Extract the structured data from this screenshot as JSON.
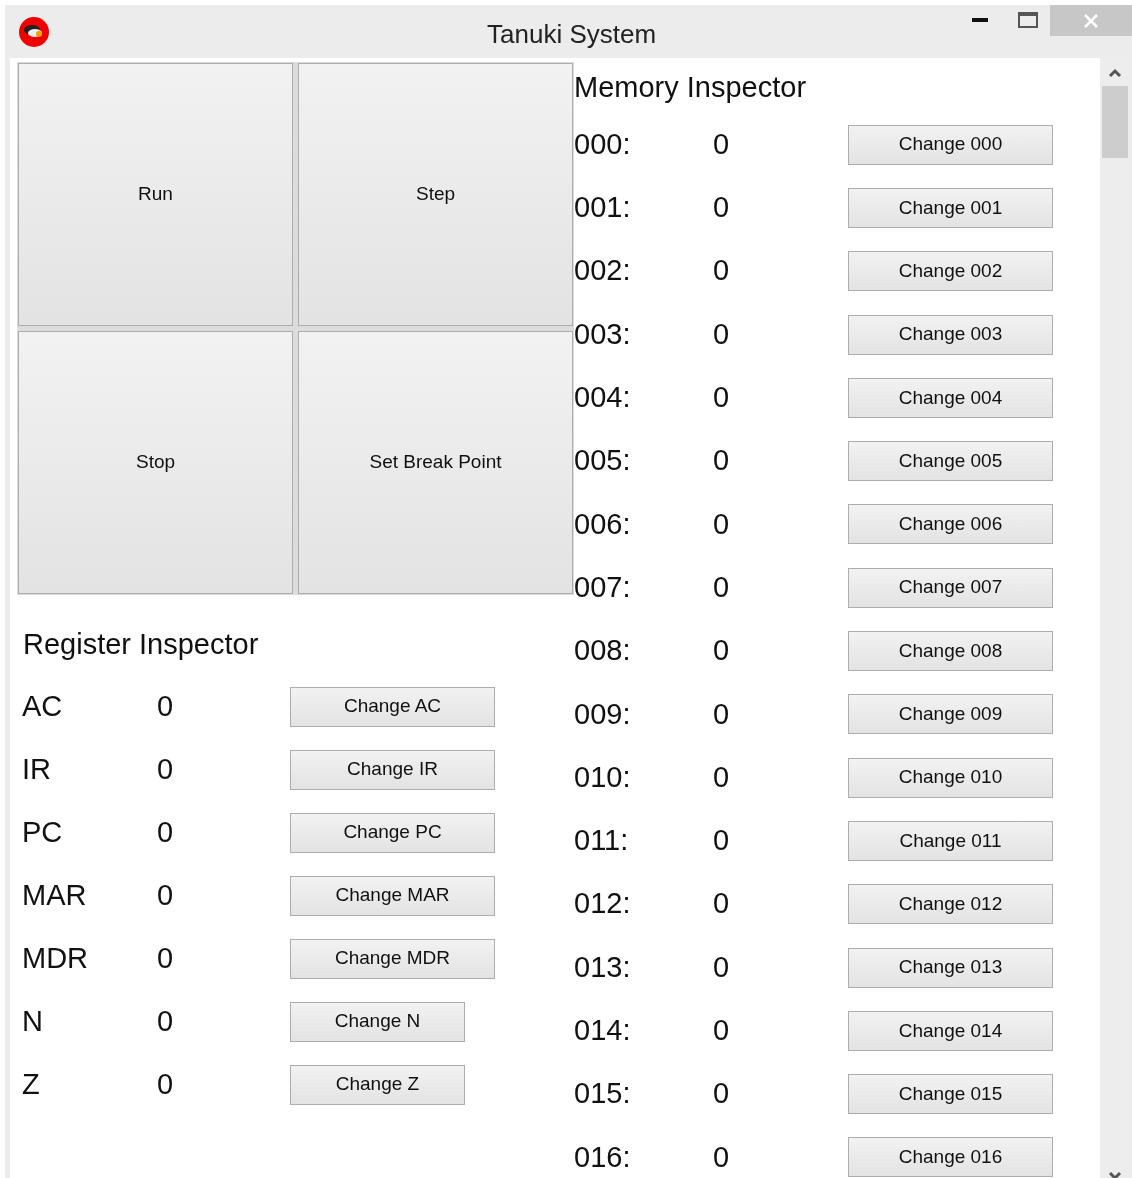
{
  "window": {
    "title": "Tanuki System"
  },
  "controls": [
    "Run",
    "Step",
    "Stop",
    "Set Break Point"
  ],
  "register_inspector": {
    "title": "Register Inspector",
    "rows": [
      {
        "name": "AC",
        "value": "0",
        "button": "Change AC",
        "kind": "wide"
      },
      {
        "name": "IR",
        "value": "0",
        "button": "Change IR",
        "kind": "wide"
      },
      {
        "name": "PC",
        "value": "0",
        "button": "Change PC",
        "kind": "wide"
      },
      {
        "name": "MAR",
        "value": "0",
        "button": "Change MAR",
        "kind": "wide"
      },
      {
        "name": "MDR",
        "value": "0",
        "button": "Change MDR",
        "kind": "wide"
      },
      {
        "name": "N",
        "value": "0",
        "button": "Change N",
        "kind": "narrow"
      },
      {
        "name": "Z",
        "value": "0",
        "button": "Change Z",
        "kind": "narrow"
      }
    ]
  },
  "memory_inspector": {
    "title": "Memory Inspector",
    "rows": [
      {
        "address": "000:",
        "value": "0",
        "button": "Change 000"
      },
      {
        "address": "001:",
        "value": "0",
        "button": "Change 001"
      },
      {
        "address": "002:",
        "value": "0",
        "button": "Change 002"
      },
      {
        "address": "003:",
        "value": "0",
        "button": "Change 003"
      },
      {
        "address": "004:",
        "value": "0",
        "button": "Change 004"
      },
      {
        "address": "005:",
        "value": "0",
        "button": "Change 005"
      },
      {
        "address": "006:",
        "value": "0",
        "button": "Change 006"
      },
      {
        "address": "007:",
        "value": "0",
        "button": "Change 007"
      },
      {
        "address": "008:",
        "value": "0",
        "button": "Change 008"
      },
      {
        "address": "009:",
        "value": "0",
        "button": "Change 009"
      },
      {
        "address": "010:",
        "value": "0",
        "button": "Change 010"
      },
      {
        "address": "011:",
        "value": "0",
        "button": "Change 011"
      },
      {
        "address": "012:",
        "value": "0",
        "button": "Change 012"
      },
      {
        "address": "013:",
        "value": "0",
        "button": "Change 013"
      },
      {
        "address": "014:",
        "value": "0",
        "button": "Change 014"
      },
      {
        "address": "015:",
        "value": "0",
        "button": "Change 015"
      },
      {
        "address": "016:",
        "value": "0",
        "button": "Change 016"
      }
    ]
  }
}
